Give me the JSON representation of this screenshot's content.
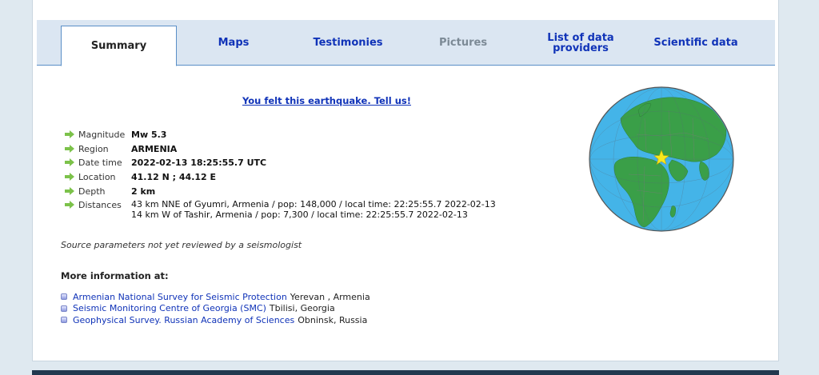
{
  "tabs": [
    {
      "label": "Summary",
      "state": "active"
    },
    {
      "label": "Maps",
      "state": "normal"
    },
    {
      "label": "Testimonies",
      "state": "normal"
    },
    {
      "label": "Pictures",
      "state": "disabled"
    },
    {
      "label": "List of data providers",
      "state": "normal"
    },
    {
      "label": "Scientific data",
      "state": "normal"
    }
  ],
  "felt_link": "You felt this earthquake. Tell us!",
  "params": {
    "magnitude": {
      "label": "Magnitude",
      "value": "Mw 5.3"
    },
    "region": {
      "label": "Region",
      "value": "ARMENIA"
    },
    "datetime": {
      "label": "Date time",
      "value": "2022-02-13 18:25:55.7 UTC"
    },
    "location": {
      "label": "Location",
      "value": "41.12 N ; 44.12 E"
    },
    "depth": {
      "label": "Depth",
      "value": "2 km"
    },
    "distances": {
      "label": "Distances",
      "lines": [
        "43 km NNE of Gyumri, Armenia / pop: 148,000 / local time: 22:25:55.7 2022-02-13",
        "14 km W of Tashir, Armenia / pop: 7,300 / local time: 22:25:55.7 2022-02-13"
      ]
    }
  },
  "review_note": "Source parameters not yet reviewed by a seismologist",
  "more_info_heading": "More information at:",
  "sources": [
    {
      "name": "Armenian National Survey for Seismic Protection",
      "place": "Yerevan , Armenia"
    },
    {
      "name": "Seismic Monitoring Centre of Georgia (SMC)",
      "place": "Tbilisi, Georgia"
    },
    {
      "name": "Geophysical Survey. Russian Academy of Sciences",
      "place": "Obninsk, Russia"
    }
  ],
  "colors": {
    "ocean": "#44b4e8",
    "land": "#3a9f48",
    "epicenter": "#f7e81c",
    "link": "#1033b8"
  }
}
